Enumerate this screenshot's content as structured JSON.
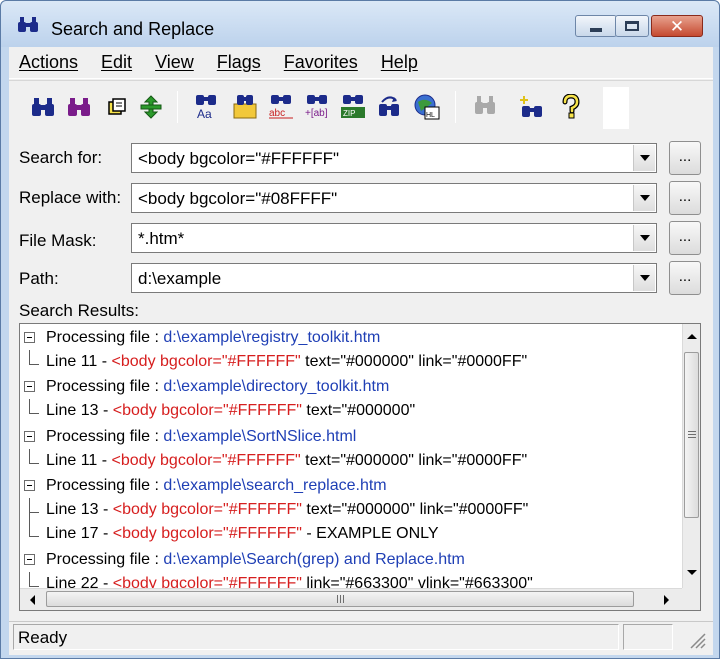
{
  "window": {
    "title": "Search and Replace",
    "close_glyph": "✕"
  },
  "menu": [
    "Actions",
    "Edit",
    "View",
    "Flags",
    "Favorites",
    "Help"
  ],
  "toolbar_icons": [
    "search-icon",
    "search-all-icon",
    "open-icon",
    "replace-icon",
    "case-icon",
    "folder-search-icon",
    "abc-icon",
    "ab-icon",
    "zip-icon",
    "undo-icon",
    "html-icon",
    "disabled-search-icon",
    "wildcard-search-icon",
    "help-icon"
  ],
  "fields": {
    "search_label": "Search for:",
    "search_value": "<body bgcolor=\"#FFFFFF\"",
    "replace_label": "Replace with:",
    "replace_value": "<body bgcolor=\"#08FFFF\"",
    "mask_label": "File Mask:",
    "mask_value": "*.htm*",
    "path_label": "Path:",
    "path_value": "d:\\example",
    "browse_label": "..."
  },
  "results": {
    "label": "Search Results:",
    "rows": [
      {
        "type": "file",
        "prefix": "Processing file : ",
        "path": "d:\\example\\registry_toolkit.htm"
      },
      {
        "type": "line",
        "lineno": "Line  11 - ",
        "match": "<body bgcolor=\"#FFFFFF\"",
        "rest": " text=\"#000000\" link=\"#0000FF\""
      },
      {
        "type": "file",
        "prefix": "Processing file : ",
        "path": "d:\\example\\directory_toolkit.htm"
      },
      {
        "type": "line",
        "lineno": "Line  13 - ",
        "match": "<body bgcolor=\"#FFFFFF\"",
        "rest": " text=\"#000000\""
      },
      {
        "type": "file",
        "prefix": "Processing file : ",
        "path": "d:\\example\\SortNSlice.html"
      },
      {
        "type": "line",
        "lineno": "Line  11 - ",
        "match": "<body bgcolor=\"#FFFFFF\"",
        "rest": " text=\"#000000\" link=\"#0000FF\""
      },
      {
        "type": "file",
        "prefix": "Processing file : ",
        "path": "d:\\example\\search_replace.htm"
      },
      {
        "type": "line",
        "lineno": "Line  13 - ",
        "match": "<body bgcolor=\"#FFFFFF\"",
        "rest": " text=\"#000000\" link=\"#0000FF\""
      },
      {
        "type": "line",
        "lineno": "Line  17 - ",
        "match": "<body bgcolor=\"#FFFFFF\"",
        "rest": "  - EXAMPLE ONLY"
      },
      {
        "type": "file",
        "prefix": "Processing file : ",
        "path": "d:\\example\\Search(grep) and Replace.htm"
      },
      {
        "type": "line",
        "lineno": "Line  22 - ",
        "match": "<body bgcolor=\"#FFFFFF\"",
        "rest": " link=\"#663300\" vlink=\"#663300\""
      }
    ]
  },
  "status": {
    "text": "Ready"
  },
  "colors": {
    "path": "#1f3fb5",
    "match": "#d61e1e"
  }
}
